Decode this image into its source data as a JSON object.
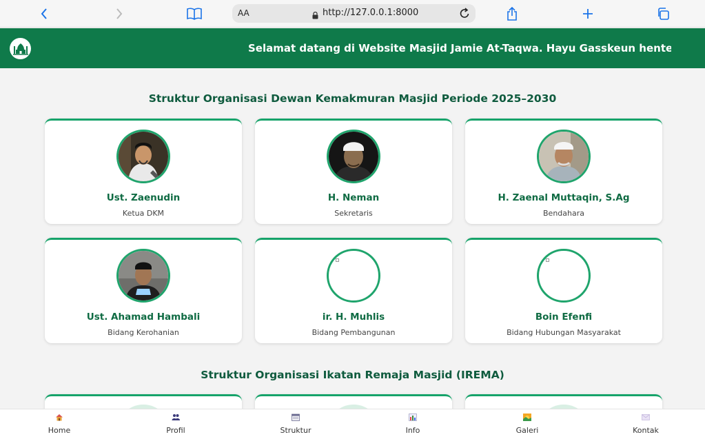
{
  "browser": {
    "text_size_label": "AA",
    "url": "http://127.0.0.1:8000"
  },
  "header": {
    "welcome_marquee": "Selamat datang di Website Masjid Jamie At-Taqwa. Hayu Gasskeun henteu urang, rek"
  },
  "dkm": {
    "title": "Struktur Organisasi Dewan Kemakmuran Masjid Periode 2025–2030",
    "members": [
      {
        "name": "Ust. Zaenudin",
        "role": "Ketua DKM"
      },
      {
        "name": "H. Neman",
        "role": "Sekretaris"
      },
      {
        "name": "H. Zaenal Muttaqin, S.Ag",
        "role": "Bendahara"
      },
      {
        "name": "Ust. Ahamad Hambali",
        "role": "Bidang Kerohanian"
      },
      {
        "name": "ir. H. Muhlis",
        "role": "Bidang Pembangunan"
      },
      {
        "name": "Boin Efenfi",
        "role": "Bidang Hubungan Masyarakat"
      }
    ]
  },
  "irema": {
    "title": "Struktur Organisasi Ikatan Remaja Masjid (IREMA)"
  },
  "nav": {
    "items": [
      {
        "label": "Home",
        "icon": "home-icon"
      },
      {
        "label": "Profil",
        "icon": "people-icon"
      },
      {
        "label": "Struktur",
        "icon": "calendar-icon"
      },
      {
        "label": "Info",
        "icon": "chart-icon"
      },
      {
        "label": "Galeri",
        "icon": "picture-icon"
      },
      {
        "label": "Kontak",
        "icon": "envelope-icon"
      }
    ]
  },
  "colors": {
    "brand_green": "#0f7a4a",
    "accent_green": "#1fa46c",
    "browser_blue": "#1a73e8"
  }
}
